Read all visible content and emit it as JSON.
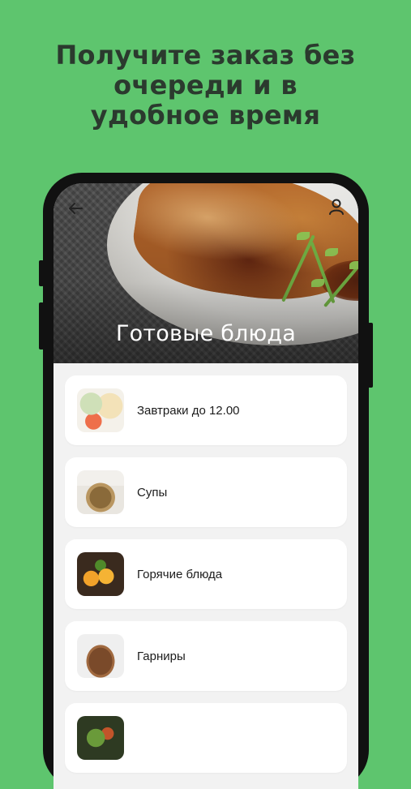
{
  "promo": {
    "title_lines": [
      "Получите заказ без",
      "очереди и в",
      "удобное время"
    ]
  },
  "screen": {
    "header": {
      "title": "Готовые блюда",
      "back_icon": "arrow-left-icon",
      "profile_icon": "user-icon"
    },
    "categories": [
      {
        "label": "Завтраки до 12.00",
        "image": "breakfast"
      },
      {
        "label": "Супы",
        "image": "soup"
      },
      {
        "label": "Горячие блюда",
        "image": "hot-dishes"
      },
      {
        "label": "Гарниры",
        "image": "side-dishes"
      },
      {
        "label": "",
        "image": "salad"
      }
    ]
  },
  "colors": {
    "background": "#5ec56e",
    "promo_text": "#2b3a2e",
    "card": "#ffffff",
    "list_background": "#f2f2f2"
  }
}
